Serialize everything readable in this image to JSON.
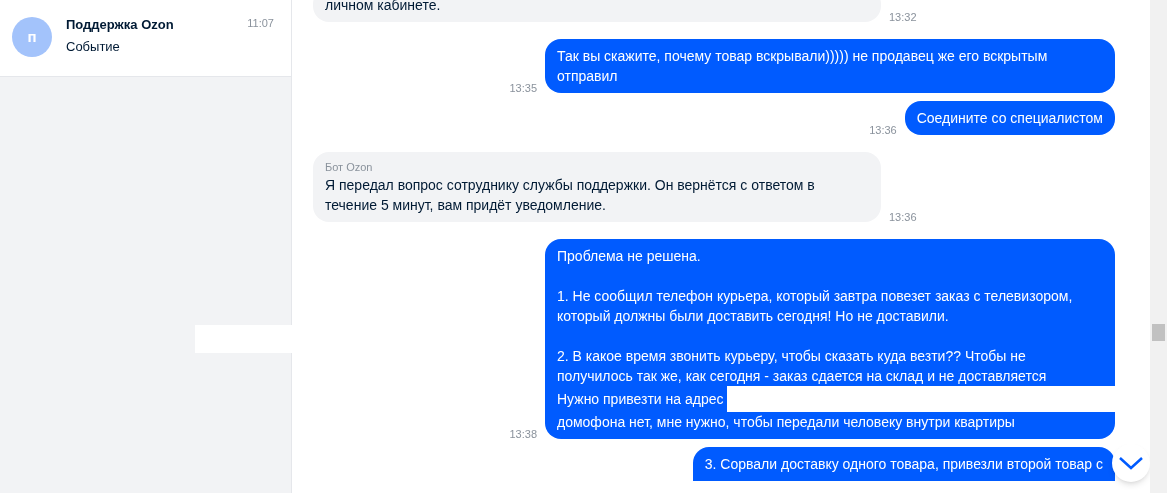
{
  "sidebar": {
    "chats": [
      {
        "avatar": "п",
        "name": "Поддержка Ozon",
        "time": "11:07",
        "preview": "Событие",
        "selected": true
      }
    ],
    "redacted": true
  },
  "messages": [
    {
      "kind": "incoming",
      "time": "13:32",
      "blocks": [
        {
          "kind": "text",
          "text": "личном кабинете."
        }
      ]
    },
    {
      "kind": "outgoing",
      "time": "13:35",
      "blocks": [
        {
          "kind": "text",
          "text": "Так вы скажите, почему товар вскрывали))))) не продавец же его вскрытым отправил"
        }
      ]
    },
    {
      "kind": "outgoing",
      "time": "13:36",
      "blocks": [
        {
          "kind": "text",
          "text": "Соедините со специалистом"
        }
      ]
    },
    {
      "kind": "incoming",
      "sender": "Бот Ozon",
      "time": "13:36",
      "blocks": [
        {
          "kind": "text",
          "text": "Я передал вопрос сотруднику службы поддержки. Он вернётся с ответом в течение 5 минут, вам придёт уведомление."
        }
      ]
    },
    {
      "kind": "outgoing",
      "time": "13:38",
      "blocks": [
        {
          "kind": "text",
          "text": "Проблема не решена."
        },
        {
          "kind": "gap"
        },
        {
          "kind": "text",
          "text": "1. Не сообщил телефон курьера, который завтра повезет заказ с телевизором, который должны были доставить сегодня! Но не доставили."
        },
        {
          "kind": "gap"
        },
        {
          "kind": "text",
          "text": "2. В какое время звонить курьеру, чтобы сказать куда везти?? Чтобы не получилось так же, как сегодня - заказ сдается на склад и не доставляется"
        },
        {
          "kind": "redacted",
          "text": "Нужно привезти на адрес"
        },
        {
          "kind": "text",
          "text": "домофона нет, мне нужно, чтобы передали человеку внутри квартиры"
        }
      ]
    },
    {
      "kind": "outgoing",
      "blocks": [
        {
          "kind": "text",
          "text": "3. Сорвали доставку одного товара, привезли второй товар с"
        }
      ]
    }
  ]
}
